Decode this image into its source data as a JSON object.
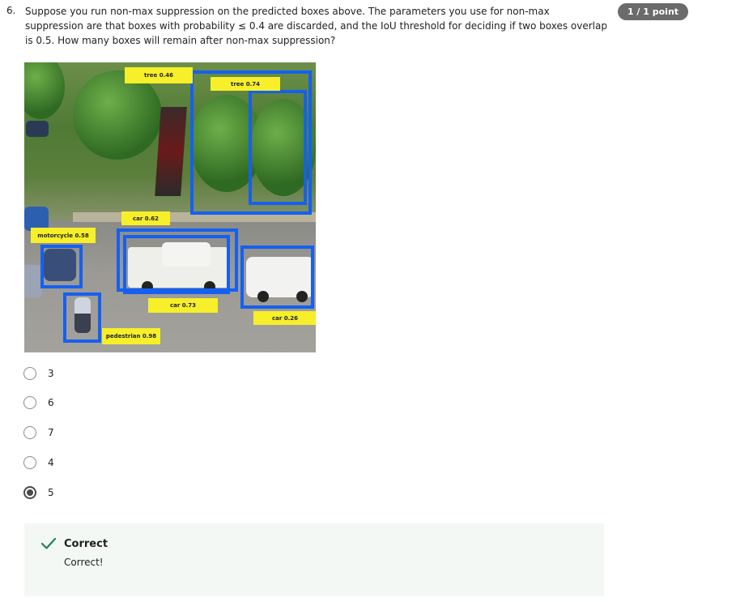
{
  "question": {
    "number": "6.",
    "text": "Suppose you run non-max suppression on the predicted boxes above. The parameters you use for non-max suppression are that boxes with probability ≤ 0.4 are discarded, and the IoU threshold for deciding if two boxes overlap is 0.5. How many boxes will remain after non-max suppression?",
    "points": "1 / 1 point"
  },
  "image_labels": {
    "tree_046": "tree 0.46",
    "tree_074": "tree 0.74",
    "car_062": "car 0.62",
    "motorcycle_058": "motorcycle 0.58",
    "car_073": "car 0.73",
    "car_026": "car 0.26",
    "pedestrian_098": "pedestrian 0.98"
  },
  "options": [
    {
      "label": "3",
      "selected": false
    },
    {
      "label": "6",
      "selected": false
    },
    {
      "label": "7",
      "selected": false
    },
    {
      "label": "4",
      "selected": false
    },
    {
      "label": "5",
      "selected": true
    }
  ],
  "feedback": {
    "title": "Correct",
    "text": "Correct!",
    "accent": "#1f8354"
  },
  "colors": {
    "box_border": "#1560f0",
    "label_bg": "#f6ef2a",
    "badge_bg": "#6b6b6b"
  }
}
